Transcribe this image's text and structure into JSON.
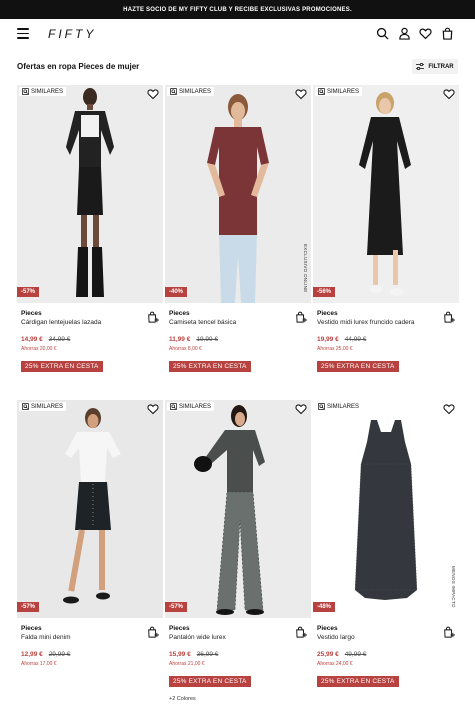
{
  "promo_bar": "HAZTE SOCIO DE MY FIFTY CLUB Y RECIBE EXCLUSIVAS PROMOCIONES.",
  "header": {
    "logo": "FIFTY"
  },
  "listing": {
    "title": "Ofertas en ropa Pieces de mujer",
    "filter_label": "FILTRAR"
  },
  "colors": {
    "accent": "#b8423f",
    "promo_bg": "#111111"
  },
  "products": [
    {
      "similares": "SIMILARES",
      "discount": "-57%",
      "brand": "Pieces",
      "name": "Cárdigan lentejuelas lazada",
      "price": "14,99 €",
      "old_price": "34,99 €",
      "savings": "Ahorras 20,00 €",
      "extra": "25% EXTRA EN CESTA"
    },
    {
      "similares": "SIMILARES",
      "discount": "-40%",
      "brand": "Pieces",
      "name": "Camiseta tencel básica",
      "price": "11,99 €",
      "old_price": "19,99 €",
      "savings": "Ahorras 8,00 €",
      "extra": "25% EXTRA EN CESTA",
      "side_label": "EXCLUSIVO ONLINE"
    },
    {
      "similares": "SIMILARES",
      "discount": "-56%",
      "brand": "Pieces",
      "name": "Vestido midi lurex fruncido cadera",
      "price": "19,99 €",
      "old_price": "44,99 €",
      "savings": "Ahorras 25,00 €",
      "extra": "25% EXTRA EN CESTA"
    },
    {
      "similares": "SIMILARES",
      "discount": "-57%",
      "brand": "Pieces",
      "name": "Falda mini denim",
      "price": "12,99 €",
      "old_price": "29,99 €",
      "savings": "Ahorras 17,00 €",
      "extra": ""
    },
    {
      "similares": "SIMILARES",
      "discount": "-57%",
      "brand": "Pieces",
      "name": "Pantalón wide lurex",
      "price": "15,99 €",
      "old_price": "36,99 €",
      "savings": "Ahorras 21,00 €",
      "extra": "25% EXTRA EN CESTA",
      "colors_note": "+2 Colores"
    },
    {
      "similares": "SIMILARES",
      "discount": "-48%",
      "brand": "Pieces",
      "name": "Vestido largo",
      "price": "25,99 €",
      "old_price": "49,99 €",
      "savings": "Ahorras 24,00 €",
      "extra": "25% EXTRA EN CESTA",
      "side_label": "MENOS IMPACTO"
    }
  ]
}
